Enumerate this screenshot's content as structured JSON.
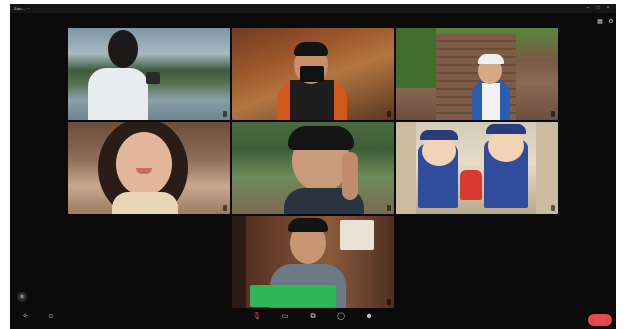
{
  "window": {
    "title": "Zalo – ···",
    "minimize_icon": "minimize-icon",
    "maximize_icon": "maximize-icon",
    "close_icon": "close-icon"
  },
  "top_tools": [
    {
      "icon": "grid-view-icon",
      "glyph": "▦"
    },
    {
      "icon": "settings-icon",
      "glyph": "⚙"
    }
  ],
  "participants": [
    {
      "name": "",
      "active": true
    },
    {
      "name": "",
      "active": false
    },
    {
      "name": "",
      "active": false
    },
    {
      "name": "",
      "active": false
    },
    {
      "name": "",
      "active": false
    },
    {
      "name": "",
      "active": false
    },
    {
      "name": "",
      "active": false
    }
  ],
  "chat_popup": {
    "lines": [
      "",
      "",
      ""
    ]
  },
  "toolbar": {
    "left": [
      {
        "icon": "effects-icon",
        "glyph": "✧",
        "label": ""
      },
      {
        "icon": "emoji-icon",
        "glyph": "☺",
        "label": ""
      }
    ],
    "center": [
      {
        "icon": "microphone-icon",
        "glyph": "🎙",
        "label": ""
      },
      {
        "icon": "camera-icon",
        "glyph": "▭",
        "label": ""
      },
      {
        "icon": "share-screen-icon",
        "glyph": "⧉",
        "label": ""
      },
      {
        "icon": "chat-icon",
        "glyph": "◯",
        "label": ""
      },
      {
        "icon": "participants-icon",
        "glyph": "☻",
        "label": ""
      }
    ],
    "end_label": ""
  },
  "colors": {
    "active_border": "#4aa86a",
    "chat_popup": "#2eb957",
    "end_button": "#e5484d"
  }
}
